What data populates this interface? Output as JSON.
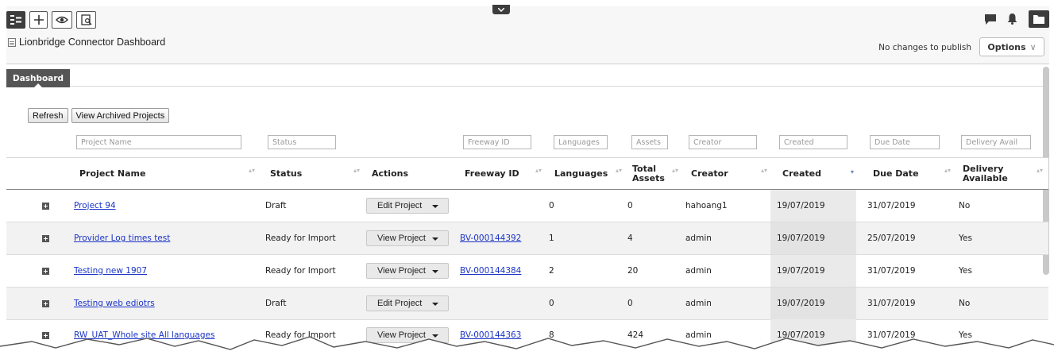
{
  "toolbar": {
    "page_title": "Lionbridge Connector Dashboard",
    "publish_status": "No changes to publish",
    "options_label": "Options",
    "options_chevron": "∨"
  },
  "tabs": [
    {
      "label": "Dashboard",
      "active": true
    }
  ],
  "buttons": {
    "refresh": "Refresh",
    "archived": "View Archived Projects"
  },
  "filters": {
    "project_name": "Project Name",
    "status": "Status",
    "freeway_id": "Freeway ID",
    "languages": "Languages",
    "assets": "Assets",
    "creator": "Creator",
    "created": "Created",
    "due_date": "Due Date",
    "delivery": "Delivery Avail"
  },
  "columns": {
    "project_name": "Project Name",
    "status": "Status",
    "actions": "Actions",
    "freeway_id": "Freeway ID",
    "languages": "Languages",
    "total_assets_1": "Total",
    "total_assets_2": "Assets",
    "creator": "Creator",
    "created": "Created",
    "due_date": "Due Date",
    "delivery_1": "Delivery",
    "delivery_2": "Available"
  },
  "sort_glyphs": {
    "neutral": "▴▾",
    "active": "▾"
  },
  "rows": [
    {
      "name": "Project 94",
      "status": "Draft",
      "action": "Edit Project",
      "freeway": "",
      "languages": "0",
      "assets": "0",
      "creator": "hahoang1",
      "created": "19/07/2019",
      "due": "31/07/2019",
      "delivery": "No"
    },
    {
      "name": "Provider Log times test",
      "status": "Ready for Import",
      "action": "View Project",
      "freeway": "BV-000144392",
      "languages": "1",
      "assets": "4",
      "creator": "admin",
      "created": "19/07/2019",
      "due": "25/07/2019",
      "delivery": "Yes"
    },
    {
      "name": "Testing new 1907",
      "status": "Ready for Import",
      "action": "View Project",
      "freeway": "BV-000144384",
      "languages": "2",
      "assets": "20",
      "creator": "admin",
      "created": "19/07/2019",
      "due": "31/07/2019",
      "delivery": "Yes"
    },
    {
      "name": "Testing web ediotrs",
      "status": "Draft",
      "action": "Edit Project",
      "freeway": "",
      "languages": "0",
      "assets": "0",
      "creator": "admin",
      "created": "19/07/2019",
      "due": "31/07/2019",
      "delivery": "No"
    },
    {
      "name": "RW_UAT_Whole site All languages",
      "status": "Ready for Import",
      "action": "View Project",
      "freeway": "BV-000144363",
      "languages": "8",
      "assets": "424",
      "creator": "admin",
      "created": "19/07/2019",
      "due": "31/07/2019",
      "delivery": "Yes"
    }
  ],
  "colors": {
    "link": "#1a33c7",
    "toolbar_dark": "#3d3d3d",
    "sort_active": "#6a7fb8"
  }
}
